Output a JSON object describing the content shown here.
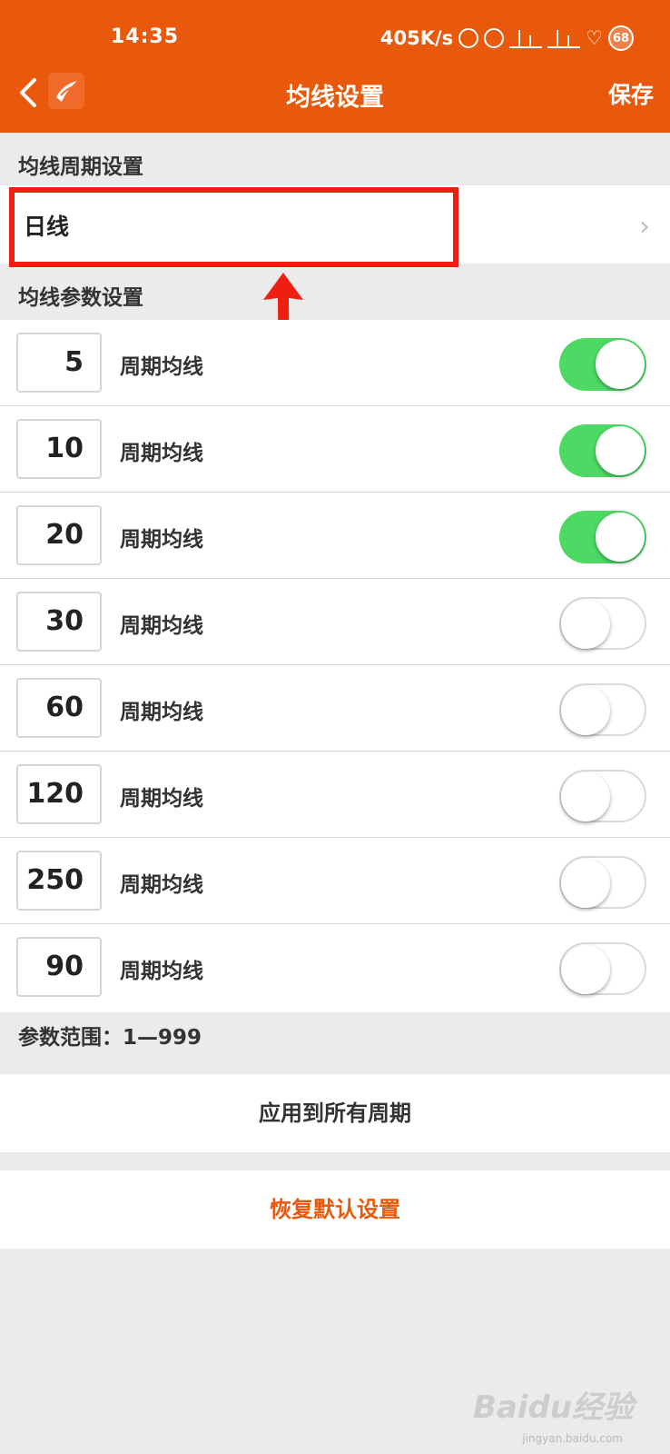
{
  "status_bar": {
    "time": "14:35",
    "network_speed": "405K/s",
    "battery": "68",
    "icons": [
      "bluetooth-icon",
      "alarm-icon",
      "signal-hd-icon",
      "signal-hd-icon",
      "heart-icon",
      "battery-icon"
    ]
  },
  "nav": {
    "back_icon": "chevron-left-icon",
    "logo": "app-logo-icon",
    "title": "均线设置",
    "save_label": "保存"
  },
  "period_section": {
    "header": "均线周期设置",
    "value": "日线",
    "chevron": "›"
  },
  "params_section": {
    "header": "均线参数设置",
    "rows": [
      {
        "value": "5",
        "label": "周期均线",
        "enabled": true
      },
      {
        "value": "10",
        "label": "周期均线",
        "enabled": true
      },
      {
        "value": "20",
        "label": "周期均线",
        "enabled": true
      },
      {
        "value": "30",
        "label": "周期均线",
        "enabled": false
      },
      {
        "value": "60",
        "label": "周期均线",
        "enabled": false
      },
      {
        "value": "120",
        "label": "周期均线",
        "enabled": false
      },
      {
        "value": "250",
        "label": "周期均线",
        "enabled": false
      },
      {
        "value": "90",
        "label": "周期均线",
        "enabled": false
      }
    ],
    "range_note": "参数范围：1—999"
  },
  "actions": {
    "apply_all": "应用到所有周期",
    "restore_default": "恢复默认设置"
  },
  "watermark": {
    "text": "Baidu经验",
    "sub": "jingyan.baidu.com"
  },
  "colors": {
    "brand": "#e8590b",
    "toggle_on": "#4cd964",
    "annotation": "#f01e12"
  }
}
